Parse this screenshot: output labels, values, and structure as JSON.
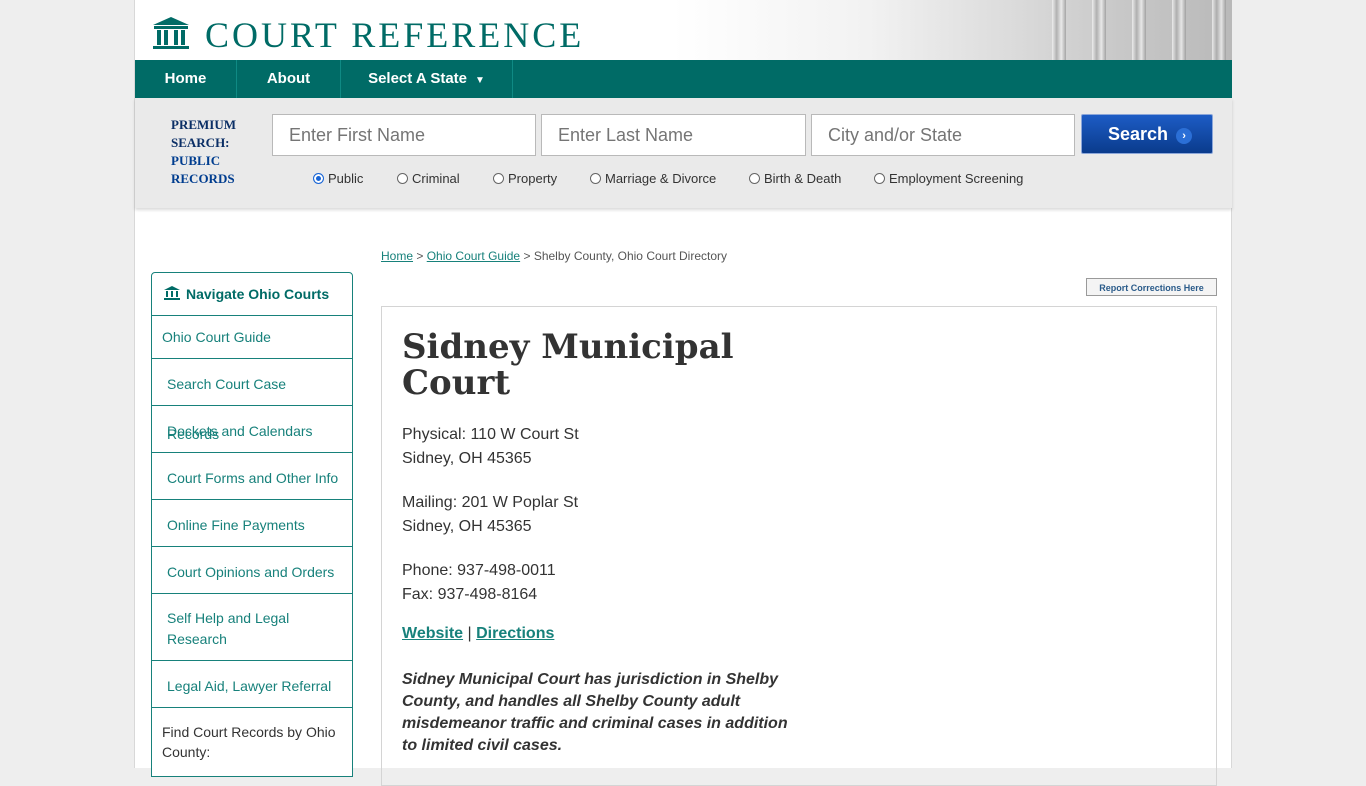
{
  "header": {
    "logo_text": "COURT REFERENCE"
  },
  "nav": {
    "home": "Home",
    "about": "About",
    "select_state": "Select A State",
    "caret": "▼"
  },
  "search": {
    "premium_line1": "PREMIUM",
    "premium_line2": "SEARCH:",
    "premium_line3": "PUBLIC",
    "premium_line4": "RECORDS",
    "first_name_placeholder": "Enter First Name",
    "last_name_placeholder": "Enter Last Name",
    "city_placeholder": "City and/or State",
    "button_label": "Search",
    "button_arrow": "›",
    "options": [
      "Public",
      "Criminal",
      "Property",
      "Marriage & Divorce",
      "Birth & Death",
      "Employment Screening"
    ],
    "selected_option": "Public"
  },
  "sidebar": {
    "heading": "Navigate Ohio Courts",
    "items": [
      "Ohio Court Guide",
      "Search Court Case Records",
      "Dockets and Calendars",
      "Court Forms and Other Info",
      "Online Fine Payments",
      "Court Opinions and Orders",
      "Self Help and Legal Research",
      "Legal Aid, Lawyer Referral"
    ],
    "find_label": "Find Court Records by Ohio County:"
  },
  "breadcrumb": {
    "home": "Home",
    "sep": ">",
    "guide": "Ohio Court Guide",
    "current": "Shelby County, Ohio Court Directory"
  },
  "report_button": "Report Corrections Here",
  "court": {
    "name": "Sidney Municipal Court",
    "physical_line1": "Physical: 110 W Court St",
    "physical_line2": "Sidney, OH 45365",
    "mailing_line1": "Mailing: 201 W Poplar St",
    "mailing_line2": "Sidney, OH 45365",
    "phone": "Phone: 937-498-0011",
    "fax": "Fax: 937-498-8164",
    "website_link": "Website",
    "link_sep": "|",
    "directions_link": "Directions",
    "description": "Sidney Municipal Court has jurisdiction in Shelby County, and handles all Shelby County adult misdemeanor traffic and criminal cases in addition to limited civil cases."
  }
}
